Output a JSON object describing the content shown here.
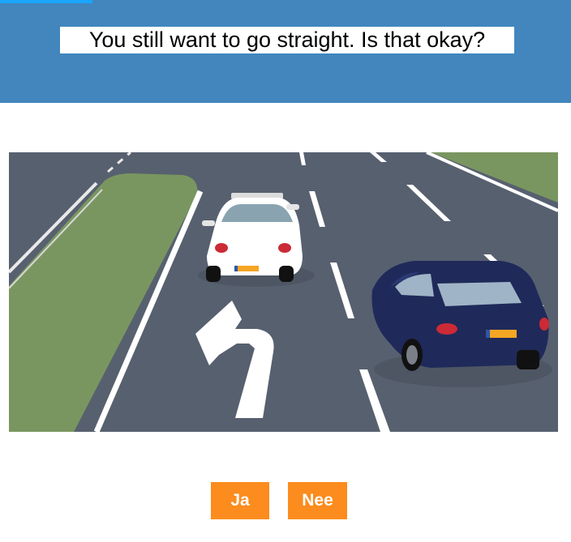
{
  "header": {
    "question": "You still want to go straight. Is that okay?",
    "color": "#4286bd",
    "progress_color": "#1aa6ff"
  },
  "scene": {
    "road_color": "#57606f",
    "grass_color": "#7a9660",
    "white_car_plate_color": "#f5a623",
    "blue_car_color": "#1f2a5a",
    "icons": [
      "turn-left-arrow-road-marking",
      "white-car",
      "dark-blue-car"
    ]
  },
  "buttons": {
    "yes": "Ja",
    "no": "Nee",
    "color": "#fb8c1d"
  }
}
